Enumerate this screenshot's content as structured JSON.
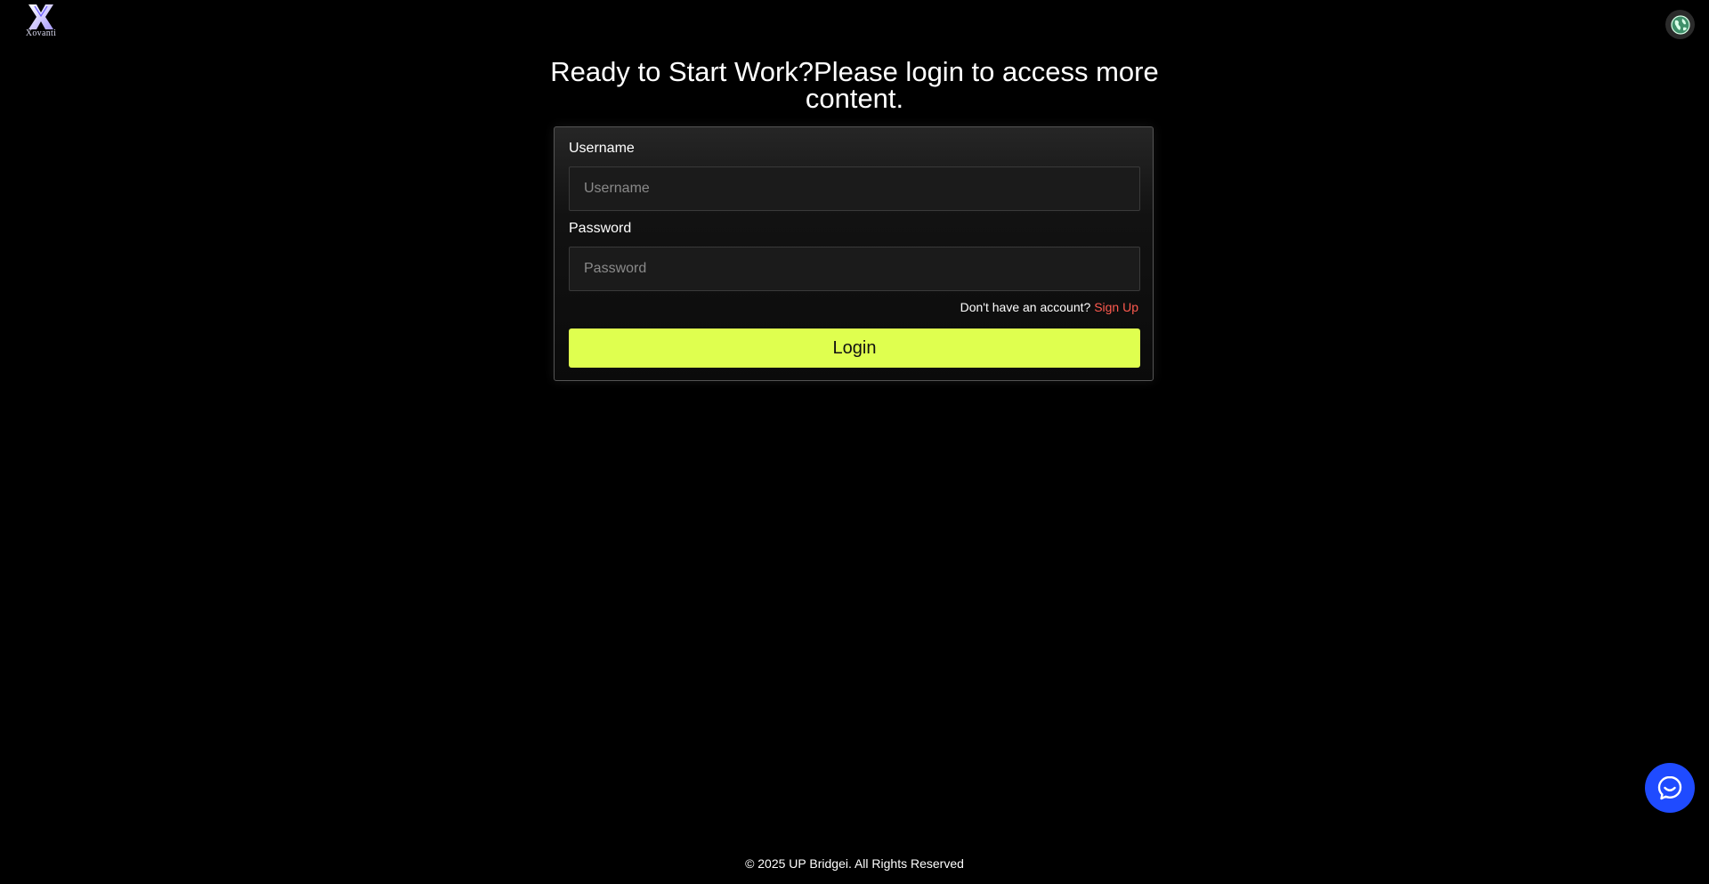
{
  "brand": {
    "logo_icon": "x-logo-icon",
    "name": "Xovanti",
    "logo_color": "#b9a9ff"
  },
  "header": {
    "language_icon": "globe-icon"
  },
  "login": {
    "heading": "Ready to Start Work?Please login to access more content.",
    "username_label": "Username",
    "username_placeholder": "Username",
    "username_value": "",
    "password_label": "Password",
    "password_placeholder": "Password",
    "password_value": "",
    "signup_prompt": "Don't have an account?",
    "signup_link": "Sign Up",
    "login_button": "Login",
    "accent_color": "#dfff4f",
    "link_color": "#ff5a4f"
  },
  "chat": {
    "icon": "chat-icon",
    "color": "#1f4bff"
  },
  "footer": {
    "copyright": "© 2025 UP Bridgei. All Rights Reserved"
  }
}
